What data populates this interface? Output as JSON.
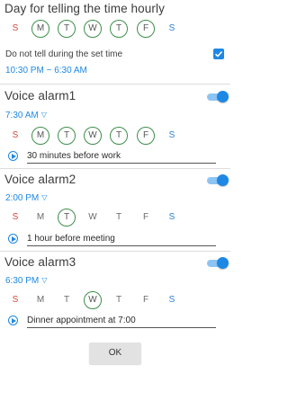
{
  "hourly": {
    "title": "Day for telling the time hourly",
    "days": [
      "S",
      "M",
      "T",
      "W",
      "T",
      "F",
      "S"
    ],
    "selected": [
      false,
      true,
      true,
      true,
      true,
      true,
      false
    ],
    "dnd_label": "Do not tell during the set time",
    "dnd_checked": true,
    "time_range": "10:30 PM ~ 6:30 AM"
  },
  "alarms": [
    {
      "name": "Voice alarm1",
      "time": "7:30 AM",
      "enabled": true,
      "selected": [
        false,
        true,
        true,
        true,
        true,
        true,
        false
      ],
      "message": "30 minutes before work"
    },
    {
      "name": "Voice alarm2",
      "time": "2:00 PM",
      "enabled": true,
      "selected": [
        false,
        false,
        true,
        false,
        false,
        false,
        false
      ],
      "message": "1 hour before meeting"
    },
    {
      "name": "Voice alarm3",
      "time": "6:30 PM",
      "enabled": true,
      "selected": [
        false,
        false,
        false,
        true,
        false,
        false,
        false
      ],
      "message": "Dinner appointment at 7:00"
    }
  ],
  "ok_label": "OK",
  "colors": {
    "accent": "#1e88e5",
    "selected_ring": "#3f8f4a",
    "sunday": "#d4483b",
    "saturday": "#2d7fd0"
  }
}
